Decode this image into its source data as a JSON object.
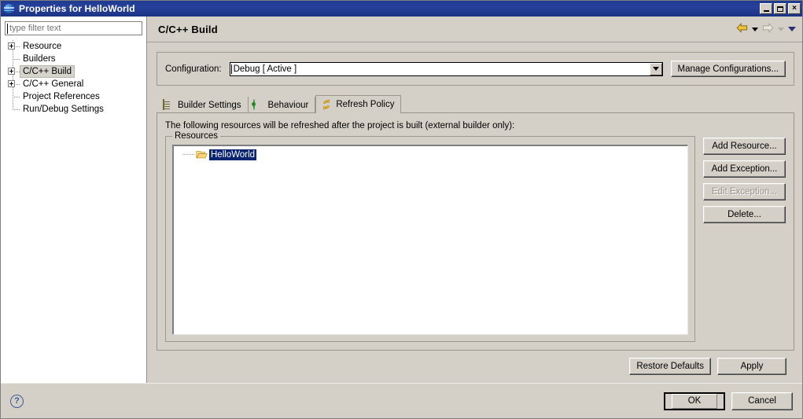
{
  "window": {
    "title": "Properties for HelloWorld",
    "icon": "globe-icon",
    "controls": {
      "minimize": "_",
      "maximize": "□",
      "close": "×"
    }
  },
  "sidebar": {
    "filter": {
      "placeholder": "type filter text",
      "value": ""
    },
    "items": [
      {
        "label": "Resource",
        "expandable": true,
        "selected": false
      },
      {
        "label": "Builders",
        "expandable": false,
        "selected": false
      },
      {
        "label": "C/C++ Build",
        "expandable": true,
        "selected": true
      },
      {
        "label": "C/C++ General",
        "expandable": true,
        "selected": false
      },
      {
        "label": "Project References",
        "expandable": false,
        "selected": false
      },
      {
        "label": "Run/Debug Settings",
        "expandable": false,
        "selected": false
      }
    ]
  },
  "header": {
    "title": "C/C++ Build",
    "nav": {
      "back_icon": "back-arrow-icon",
      "back_menu_icon": "chevron-down-icon",
      "forward_icon": "forward-arrow-icon",
      "forward_menu_icon": "chevron-down-icon",
      "restore_icon": "chevron-down-icon"
    }
  },
  "configuration": {
    "label": "Configuration:",
    "value": "Debug  [ Active ]",
    "dropdown_icon": "chevron-down-icon",
    "manage_button": "Manage Configurations..."
  },
  "tabs": [
    {
      "label": "Builder Settings",
      "icon": "list-document-icon",
      "active": false
    },
    {
      "label": "Behaviour",
      "icon": "target-icon",
      "active": false
    },
    {
      "label": "Refresh Policy",
      "icon": "refresh-icon",
      "active": true
    }
  ],
  "refresh_policy": {
    "description": "The following resources will be refreshed after the project is built (external builder only):",
    "group_label": "Resources",
    "resources": [
      {
        "label": "HelloWorld",
        "icon": "open-folder-icon",
        "selected": true
      }
    ],
    "buttons": [
      {
        "label": "Add Resource...",
        "enabled": true
      },
      {
        "label": "Add Exception...",
        "enabled": true
      },
      {
        "label": "Edit Exception...",
        "enabled": false
      },
      {
        "label": "Delete...",
        "enabled": true
      }
    ]
  },
  "page_actions": {
    "restore_defaults": "Restore Defaults",
    "apply": "Apply"
  },
  "dialog_actions": {
    "help_icon": "help-icon",
    "help_glyph": "?",
    "ok": "OK",
    "cancel": "Cancel"
  },
  "colors": {
    "title_bar": "#1f3a8f",
    "face": "#d4d0c8",
    "selection": "#0a2472",
    "accent_yellow": "#e0b010",
    "accent_green": "#1f8a28"
  }
}
